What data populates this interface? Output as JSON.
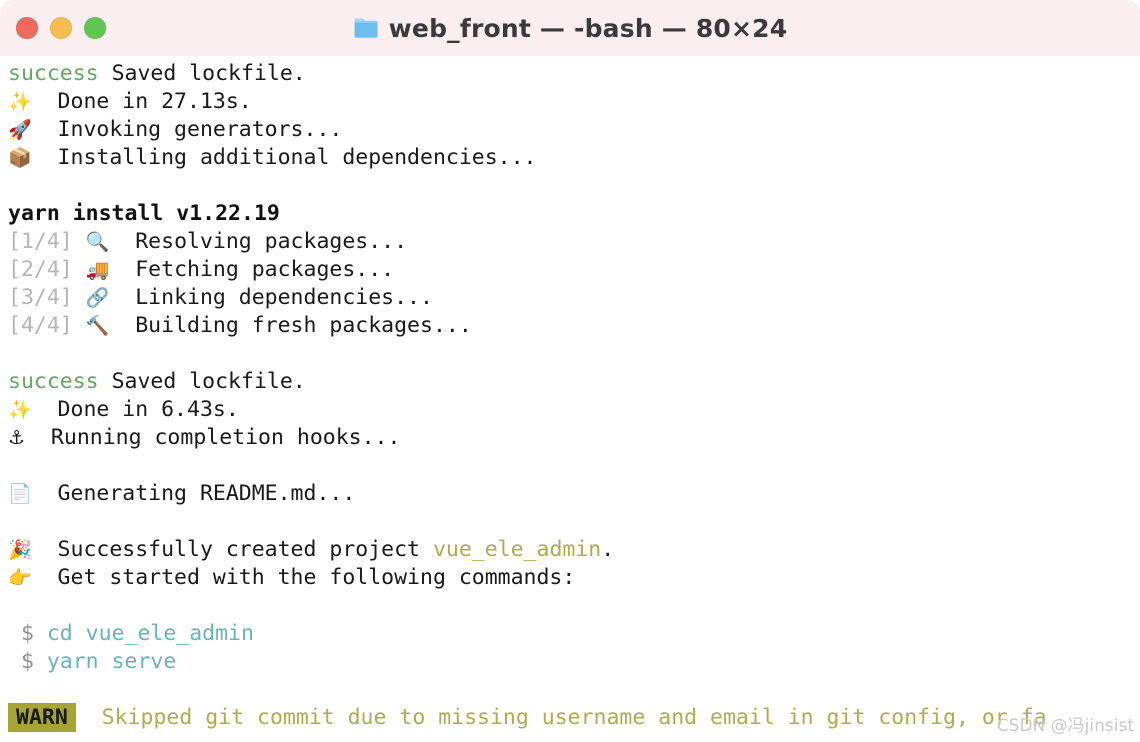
{
  "window": {
    "titlebar_bg": "#faeef1",
    "body_bg": "#ffffff",
    "traffic_lights": [
      {
        "name": "close",
        "color": "#ed6a5e"
      },
      {
        "name": "minimize",
        "color": "#f4bd4f"
      },
      {
        "name": "zoom",
        "color": "#61c554"
      }
    ],
    "folder_icon": "folder-icon",
    "title": "web_front — -bash — 80×24"
  },
  "colors": {
    "success_green": "#62a862",
    "gray": "#b5b5b5",
    "dollar_gray": "#919191",
    "teal": "#6bb2bd",
    "olive": "#adad4f",
    "warn_badge_bg": "#a6a436",
    "text": "#1a1a1a"
  },
  "terminal": {
    "lines": [
      {
        "id": "line-saved-lockfile-1",
        "segments": [
          {
            "text": "success ",
            "style": "c-success"
          },
          {
            "text": "Saved lockfile.",
            "style": "c-default"
          }
        ]
      },
      {
        "id": "line-done-27",
        "segments": [
          {
            "text": "✨",
            "style": "emoji",
            "icon": "sparkles-emoji"
          },
          {
            "text": "  Done in 27.13s.",
            "style": "c-default"
          }
        ]
      },
      {
        "id": "line-invoking-generators",
        "segments": [
          {
            "text": "🚀",
            "style": "emoji",
            "icon": "rocket-emoji"
          },
          {
            "text": "  Invoking generators...",
            "style": "c-default"
          }
        ]
      },
      {
        "id": "line-installing-additional",
        "segments": [
          {
            "text": "📦",
            "style": "emoji",
            "icon": "package-emoji"
          },
          {
            "text": "  Installing additional dependencies...",
            "style": "c-default"
          }
        ]
      },
      {
        "id": "blank-1",
        "blank": true
      },
      {
        "id": "line-yarn-install-version",
        "segments": [
          {
            "text": "yarn install v1.22.19",
            "style": "c-bold"
          }
        ]
      },
      {
        "id": "line-step-1",
        "segments": [
          {
            "text": "[1/4] ",
            "style": "c-gray"
          },
          {
            "text": "🔍",
            "style": "emoji",
            "icon": "magnifying-glass-emoji"
          },
          {
            "text": "  Resolving packages...",
            "style": "c-default"
          }
        ]
      },
      {
        "id": "line-step-2",
        "segments": [
          {
            "text": "[2/4] ",
            "style": "c-gray"
          },
          {
            "text": "🚚",
            "style": "emoji",
            "icon": "truck-emoji"
          },
          {
            "text": "  Fetching packages...",
            "style": "c-default"
          }
        ]
      },
      {
        "id": "line-step-3",
        "segments": [
          {
            "text": "[3/4] ",
            "style": "c-gray"
          },
          {
            "text": "🔗",
            "style": "emoji",
            "icon": "link-emoji"
          },
          {
            "text": "  Linking dependencies...",
            "style": "c-default"
          }
        ]
      },
      {
        "id": "line-step-4",
        "segments": [
          {
            "text": "[4/4] ",
            "style": "c-gray"
          },
          {
            "text": "🔨",
            "style": "emoji",
            "icon": "hammer-emoji"
          },
          {
            "text": "  Building fresh packages...",
            "style": "c-default"
          }
        ]
      },
      {
        "id": "blank-2",
        "blank": true
      },
      {
        "id": "line-saved-lockfile-2",
        "segments": [
          {
            "text": "success ",
            "style": "c-success"
          },
          {
            "text": "Saved lockfile.",
            "style": "c-default"
          }
        ]
      },
      {
        "id": "line-done-6",
        "segments": [
          {
            "text": "✨",
            "style": "emoji",
            "icon": "sparkles-emoji"
          },
          {
            "text": "  Done in 6.43s.",
            "style": "c-default"
          }
        ]
      },
      {
        "id": "line-completion-hooks",
        "segments": [
          {
            "text": "⚓",
            "style": "emoji",
            "icon": "anchor-emoji"
          },
          {
            "text": "  Running completion hooks...",
            "style": "c-default"
          }
        ]
      },
      {
        "id": "blank-3",
        "blank": true
      },
      {
        "id": "line-generating-readme",
        "segments": [
          {
            "text": "📄",
            "style": "emoji",
            "icon": "page-emoji"
          },
          {
            "text": "  Generating README.md...",
            "style": "c-default"
          }
        ]
      },
      {
        "id": "blank-4",
        "blank": true
      },
      {
        "id": "line-successfully-created",
        "segments": [
          {
            "text": "🎉",
            "style": "emoji",
            "icon": "party-popper-emoji"
          },
          {
            "text": "  Successfully created project ",
            "style": "c-default"
          },
          {
            "text": "vue_ele_admin",
            "style": "c-olive"
          },
          {
            "text": ".",
            "style": "c-default"
          }
        ]
      },
      {
        "id": "line-get-started",
        "segments": [
          {
            "text": "👉",
            "style": "emoji",
            "icon": "pointing-finger-emoji"
          },
          {
            "text": "  Get started with the following commands:",
            "style": "c-default"
          }
        ]
      },
      {
        "id": "blank-5",
        "blank": true
      },
      {
        "id": "line-cmd-cd",
        "segments": [
          {
            "text": " $ ",
            "style": "c-dollar"
          },
          {
            "text": "cd vue_ele_admin",
            "style": "c-teal"
          }
        ]
      },
      {
        "id": "line-cmd-yarn-serve",
        "segments": [
          {
            "text": " $ ",
            "style": "c-dollar"
          },
          {
            "text": "yarn serve",
            "style": "c-teal"
          }
        ]
      },
      {
        "id": "blank-6",
        "blank": true
      },
      {
        "id": "line-warn",
        "segments": [
          {
            "text": "WARN",
            "style": "warn-badge"
          },
          {
            "text": "  Skipped git commit due to missing username and email in git config, or fa",
            "style": "c-olive"
          }
        ]
      }
    ]
  },
  "watermark": {
    "text": "CSDN @冯jinsist"
  }
}
